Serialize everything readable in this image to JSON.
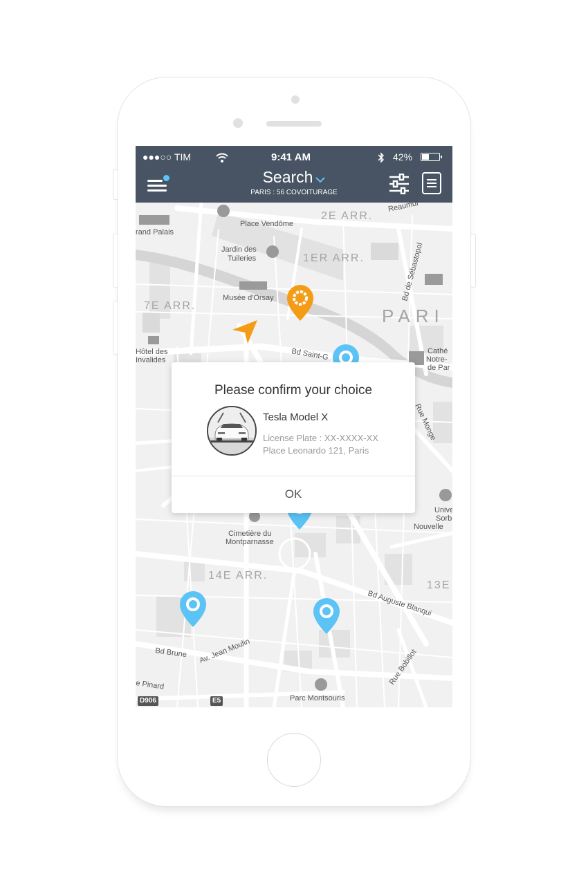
{
  "status_bar": {
    "carrier": "●●●○○ TIM",
    "time": "9:41 AM",
    "battery": "42%",
    "battery_level": 0.42,
    "icons": [
      "wifi-icon",
      "bluetooth-icon",
      "battery-icon"
    ]
  },
  "header": {
    "title": "Search",
    "subtitle": "PARIS : 56 COVOITURAGE",
    "icons": [
      "menu-icon",
      "filter-sliders-icon",
      "list-icon",
      "chevron-down-icon"
    ]
  },
  "map": {
    "labels": {
      "place_vendome": "Place Vendôme",
      "arr_2e": "2E ARR.",
      "grand_palais": "rand Palais",
      "jardin_1": "Jardin des",
      "jardin_2": "Tuileries",
      "arr_1er": "1ER ARR.",
      "reaumur": "Reaumur",
      "sebastopol": "Bd de Sébastopol",
      "orsay": "Musée d'Orsay",
      "arr_7e": "7E ARR.",
      "paris": "PARI",
      "invalides_1": "Hôtel des",
      "invalides_2": "Invalides",
      "bd_saint_g": "Bd Saint-G",
      "cathe_1": "Cathé",
      "cathe_2": "Notre-",
      "cathe_3": "de Par",
      "rue_monge": "Rue Monge",
      "univ_1": "Univer",
      "univ_2": "Sorbo",
      "univ_3": "Nouvelle",
      "cimetiere_1": "Cimetière du",
      "cimetiere_2": "Montparnasse",
      "arr_14e": "14E ARR.",
      "arr_13e": "13E",
      "bd_auguste": "Bd Auguste Blanqui",
      "bd_brune": "Bd Brune",
      "av_jean_moulin": "Av. Jean Moulin",
      "rue_bobillot": "Rue Bobillot",
      "pinard": "e Pinard",
      "parc": "Parc Montsouris",
      "d906": "D906",
      "e5": "E5"
    },
    "colors": {
      "pin_selected": "#f59c17",
      "pin_available": "#5bc3f5",
      "location_arrow": "#f59c17"
    }
  },
  "dialog": {
    "title": "Please confirm your choice",
    "car_name": "Tesla Model X",
    "plate": "License Plate : XX-XXXX-XX",
    "address": "Place Leonardo 121, Paris",
    "ok_label": "OK"
  },
  "colors": {
    "header_bg": "#3b4858",
    "accent": "#5bc3f5"
  }
}
